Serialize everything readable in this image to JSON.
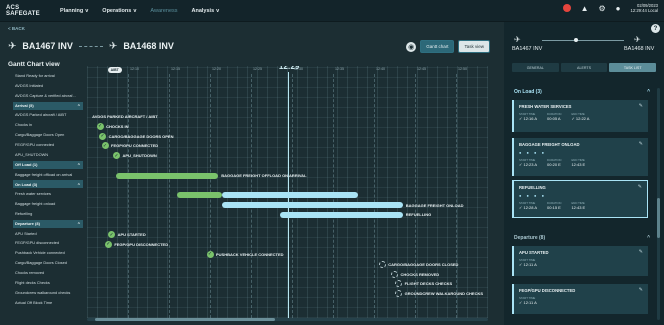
{
  "nav": {
    "logo_line1": "ACS",
    "logo_line2": "SAFEGATE",
    "items": [
      {
        "label": "Planning",
        "chevron": "v"
      },
      {
        "label": "Operations",
        "chevron": "v"
      },
      {
        "label": "Awareness",
        "chevron": ""
      },
      {
        "label": "Analysis",
        "chevron": "v"
      }
    ],
    "date": "02/09/2023",
    "time": "12:29:44 Local",
    "alert_color": "#e5453d"
  },
  "back_label": "< BACK",
  "header": {
    "from": "BA1467 INV",
    "to": "BA1468 INV",
    "btn_gantt": "Gantt chart",
    "btn_task": "Task view"
  },
  "gantt": {
    "title": "Gantt Chart view",
    "now": "12:29",
    "start_pill": "AIBT",
    "ticks": [
      "12:10",
      "12:15",
      "12:20",
      "12:25",
      "12:30",
      "12:35",
      "12:40",
      "12:45",
      "12:50"
    ],
    "rows": [
      {
        "label": "Stand Ready for arrival",
        "y": 0
      },
      {
        "label": "AVDGS Initiated",
        "y": 1
      },
      {
        "label": "AVDGS Capture & verified aircraf...",
        "y": 2
      },
      {
        "label": "Arrival (5)",
        "y": 3,
        "group": true
      },
      {
        "label": "AVDGS Parked aircraft / AIBT",
        "y": 4
      },
      {
        "label": "Chocks in",
        "y": 5
      },
      {
        "label": "Cargo/Baggage Doors Open",
        "y": 6
      },
      {
        "label": "FEGP/GPU connected",
        "y": 7
      },
      {
        "label": "APU_SHUTDOWN",
        "y": 8
      },
      {
        "label": "Off Load (1)",
        "y": 9,
        "group": true
      },
      {
        "label": "Baggage freight offload on arrival",
        "y": 10
      },
      {
        "label": "On Load (3)",
        "y": 11,
        "group": true
      },
      {
        "label": "Fresh water services",
        "y": 12
      },
      {
        "label": "Baggage freight onload",
        "y": 13
      },
      {
        "label": "Refuelling",
        "y": 14
      },
      {
        "label": "Departure (8)",
        "y": 15,
        "group": true
      },
      {
        "label": "APU Started",
        "y": 16
      },
      {
        "label": "FEGP/GPU disconnected",
        "y": 17
      },
      {
        "label": "Pushback Vehicle connected",
        "y": 18
      },
      {
        "label": "Cargo/Baggage Doors Closed",
        "y": 19
      },
      {
        "label": "Chocks removed",
        "y": 20
      },
      {
        "label": "Flight decks Checks",
        "y": 21
      },
      {
        "label": "Groundcrew walkaround checks",
        "y": 22
      },
      {
        "label": "Actual Off Block Time",
        "y": 23
      }
    ],
    "labels": {
      "avdgs": "AVDGS PARKED AIRCRAFT / AIBT",
      "chocks_in": "CHOCKS IN",
      "doors_open": "CARGO/BAGGAGE DOORS OPEN",
      "fegp_conn": "FEGP/GPU CONNECTED",
      "apu_shut": "APU_SHUTDOWN",
      "offload": "BAGGAGE FREIGHT OFFLOAD ON ARRIVAL",
      "water": "FRESH WATER SERVICES",
      "onload": "BAGGAGE FREIGHT ONLOAD",
      "refuel": "REFUELLING",
      "apu_start": "APU STARTED",
      "fegp_disc": "FEGP/GPU DISCONNECTED",
      "pushback": "PUSHBACK VEHICLE CONNECTED",
      "doors_closed": "CARGO/BAGGAGE DOORS CLOSED",
      "chocks_removed": "CHOCKS REMOVED",
      "flight_deck": "FLIGHT DECKS CHECKS",
      "walkaround": "GROUNDCREW WALKAROUND CHECKS"
    },
    "colors": {
      "done": "#7ac26b",
      "active": "#a9e3f5"
    }
  },
  "side": {
    "from": "BA1467 INV",
    "to": "BA1468 INV",
    "tabs": [
      "GENERAL",
      "ALERTS",
      "TASK LIST"
    ],
    "onload_title": "On Load (3)",
    "departure_title": "Departure (8)",
    "meta_keys": {
      "start": "START TIME",
      "duration": "DURATION",
      "end": "END TIME"
    },
    "cards": [
      {
        "title": "FRESH WATER SERVICES",
        "start": "✓ 12:16 A",
        "duration": "00:05 A",
        "end": "✓ 12:22 A"
      },
      {
        "title": "BAGGAGE FREIGHT ONLOAD",
        "start": "✓ 12:23 A",
        "duration": "00:20 E",
        "end": "12:43 E"
      },
      {
        "title": "REFUELLING",
        "start": "✓ 12:28 A",
        "duration": "00:15 E",
        "end": "12:43 E"
      }
    ],
    "dep_cards": [
      {
        "title": "APU STARTED",
        "start_key": "START TIME",
        "start": "✓ 12:11 A"
      },
      {
        "title": "FEGP/GPU DISCONNECTED",
        "start_key": "START TIME",
        "start": "✓ 12:11 A"
      }
    ]
  }
}
